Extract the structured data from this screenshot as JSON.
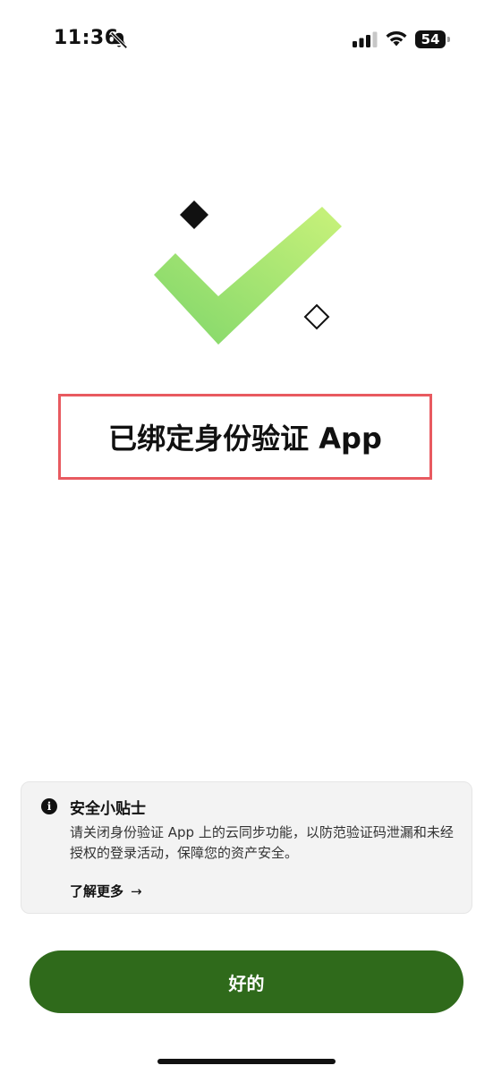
{
  "status_bar": {
    "time": "11:36",
    "battery": "54",
    "icons": [
      "bell-slash-icon",
      "signal-icon",
      "wifi-icon",
      "battery-icon"
    ]
  },
  "illustration": {
    "icons": [
      "checkmark-icon",
      "diamond-filled-icon",
      "diamond-outline-icon"
    ],
    "colors": {
      "check_light": "#c9f27a",
      "check_dark": "#7fd66a"
    }
  },
  "title": "已绑定身份验证 App",
  "tip": {
    "title": "安全小贴士",
    "body": "请关闭身份验证 App 上的云同步功能，以防范验证码泄漏和未经授权的登录活动，保障您的资产安全。",
    "learn_more": "了解更多",
    "arrow": "→"
  },
  "primary_button": {
    "label": "好的",
    "color": "#2f6a1b"
  },
  "colors": {
    "highlight_border": "#e85a60",
    "card_background": "#f3f3f3"
  }
}
